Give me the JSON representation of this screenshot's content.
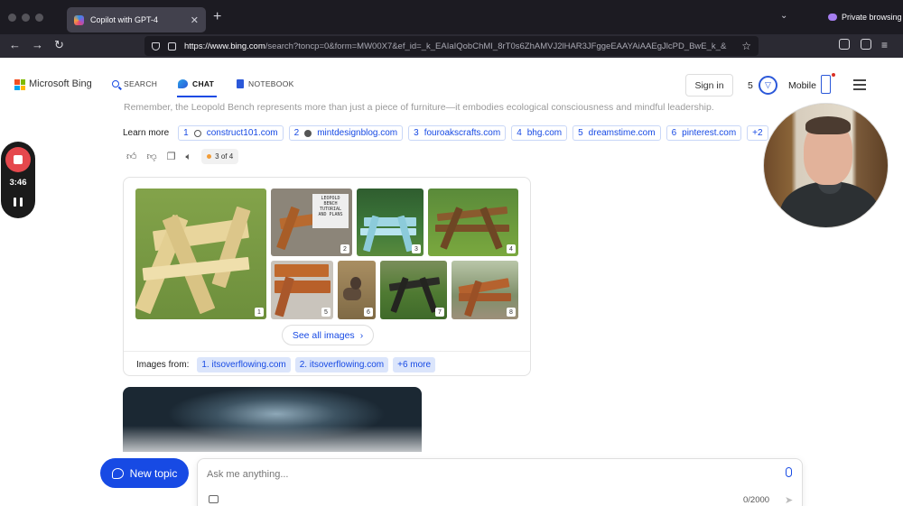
{
  "browser": {
    "tab_title": "Copilot with GPT-4",
    "url_host": "https://www.bing.com",
    "url_path": "/search?toncp=0&form=MW00X7&ef_id=_k_EAIaIQobChMI_8rT0s6ZhAMVJ2lHAR3JFggeEAAYAiAAEgJlcPD_BwE_k_&",
    "private_label": "Private browsing"
  },
  "bing": {
    "brand": "Microsoft Bing",
    "nav": [
      "SEARCH",
      "CHAT",
      "NOTEBOOK"
    ],
    "signin": "Sign in",
    "points": "5",
    "mobile": "Mobile"
  },
  "chat": {
    "faded_text": "Remember, the Leopold Bench represents more than just a piece of furniture—it embodies ecological consciousness and mindful leadership.",
    "learn_more_label": "Learn more",
    "learn_more": [
      {
        "num": "1",
        "site": "construct101.com"
      },
      {
        "num": "2",
        "site": "mintdesignblog.com"
      },
      {
        "num": "3",
        "site": "fouroakscrafts.com"
      },
      {
        "num": "4",
        "site": "bhg.com"
      },
      {
        "num": "5",
        "site": "dreamstime.com"
      },
      {
        "num": "6",
        "site": "pinterest.com"
      },
      {
        "num": "",
        "site": "+2"
      }
    ],
    "response_count": "3 of 4"
  },
  "image_card": {
    "thumb_numbers": [
      "1",
      "2",
      "3",
      "4",
      "5",
      "6",
      "7",
      "8"
    ],
    "sign_text": "LEOPOLD BENCH TUTORIAL AND PLANS",
    "see_all": "See all images",
    "images_from_label": "Images from:",
    "images_from": [
      "1. itsoverflowing.com",
      "2. itsoverflowing.com",
      "+6 more"
    ]
  },
  "composer": {
    "new_topic": "New topic",
    "placeholder": "Ask me anything...",
    "char_count": "0/2000"
  },
  "recording": {
    "time": "3:46"
  },
  "colors": {
    "accent": "#174ae4",
    "record": "#e5484d",
    "chrome_dark": "#1c1b22"
  }
}
